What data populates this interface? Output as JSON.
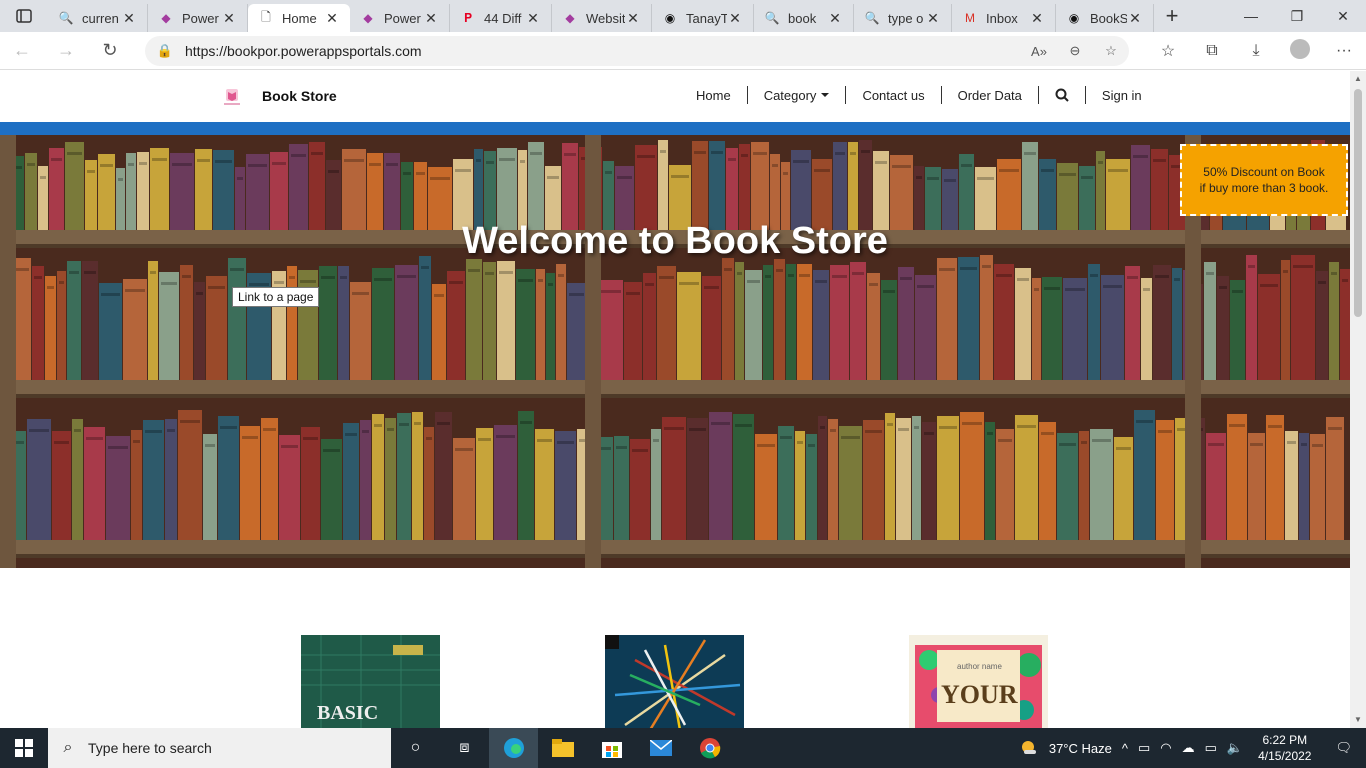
{
  "browser": {
    "tabs": [
      {
        "label": "curren",
        "icon": "search-icon",
        "active": false
      },
      {
        "label": "Power",
        "icon": "powerapps-icon",
        "active": false
      },
      {
        "label": "Home",
        "icon": "page-icon",
        "active": true
      },
      {
        "label": "Power",
        "icon": "powerapps-icon",
        "active": false
      },
      {
        "label": "44 Diff",
        "icon": "pinterest-icon",
        "active": false
      },
      {
        "label": "Websit",
        "icon": "powerapps-icon",
        "active": false
      },
      {
        "label": "TanayT",
        "icon": "github-icon",
        "active": false
      },
      {
        "label": "book",
        "icon": "search-icon",
        "active": false
      },
      {
        "label": "type o",
        "icon": "search-icon",
        "active": false
      },
      {
        "label": "Inbox",
        "icon": "gmail-icon",
        "active": false
      },
      {
        "label": "BookS",
        "icon": "github-icon",
        "active": false
      }
    ],
    "url": "https://bookpor.powerappsportals.com"
  },
  "site": {
    "brand": "Book Store",
    "nav": [
      "Home",
      "Category",
      "Contact us",
      "Order Data",
      "Sign in"
    ],
    "hero_title": "Welcome to Book Store",
    "link_button": "Link to a page",
    "promo_line1": "50% Discount on Book",
    "promo_line2": "if buy more than 3 book.",
    "accent_color": "#1e6fc3",
    "promo_color": "#f5a200"
  },
  "taskbar": {
    "search_placeholder": "Type here to search",
    "weather": "37°C  Haze",
    "time": "6:22 PM",
    "date": "4/15/2022"
  }
}
